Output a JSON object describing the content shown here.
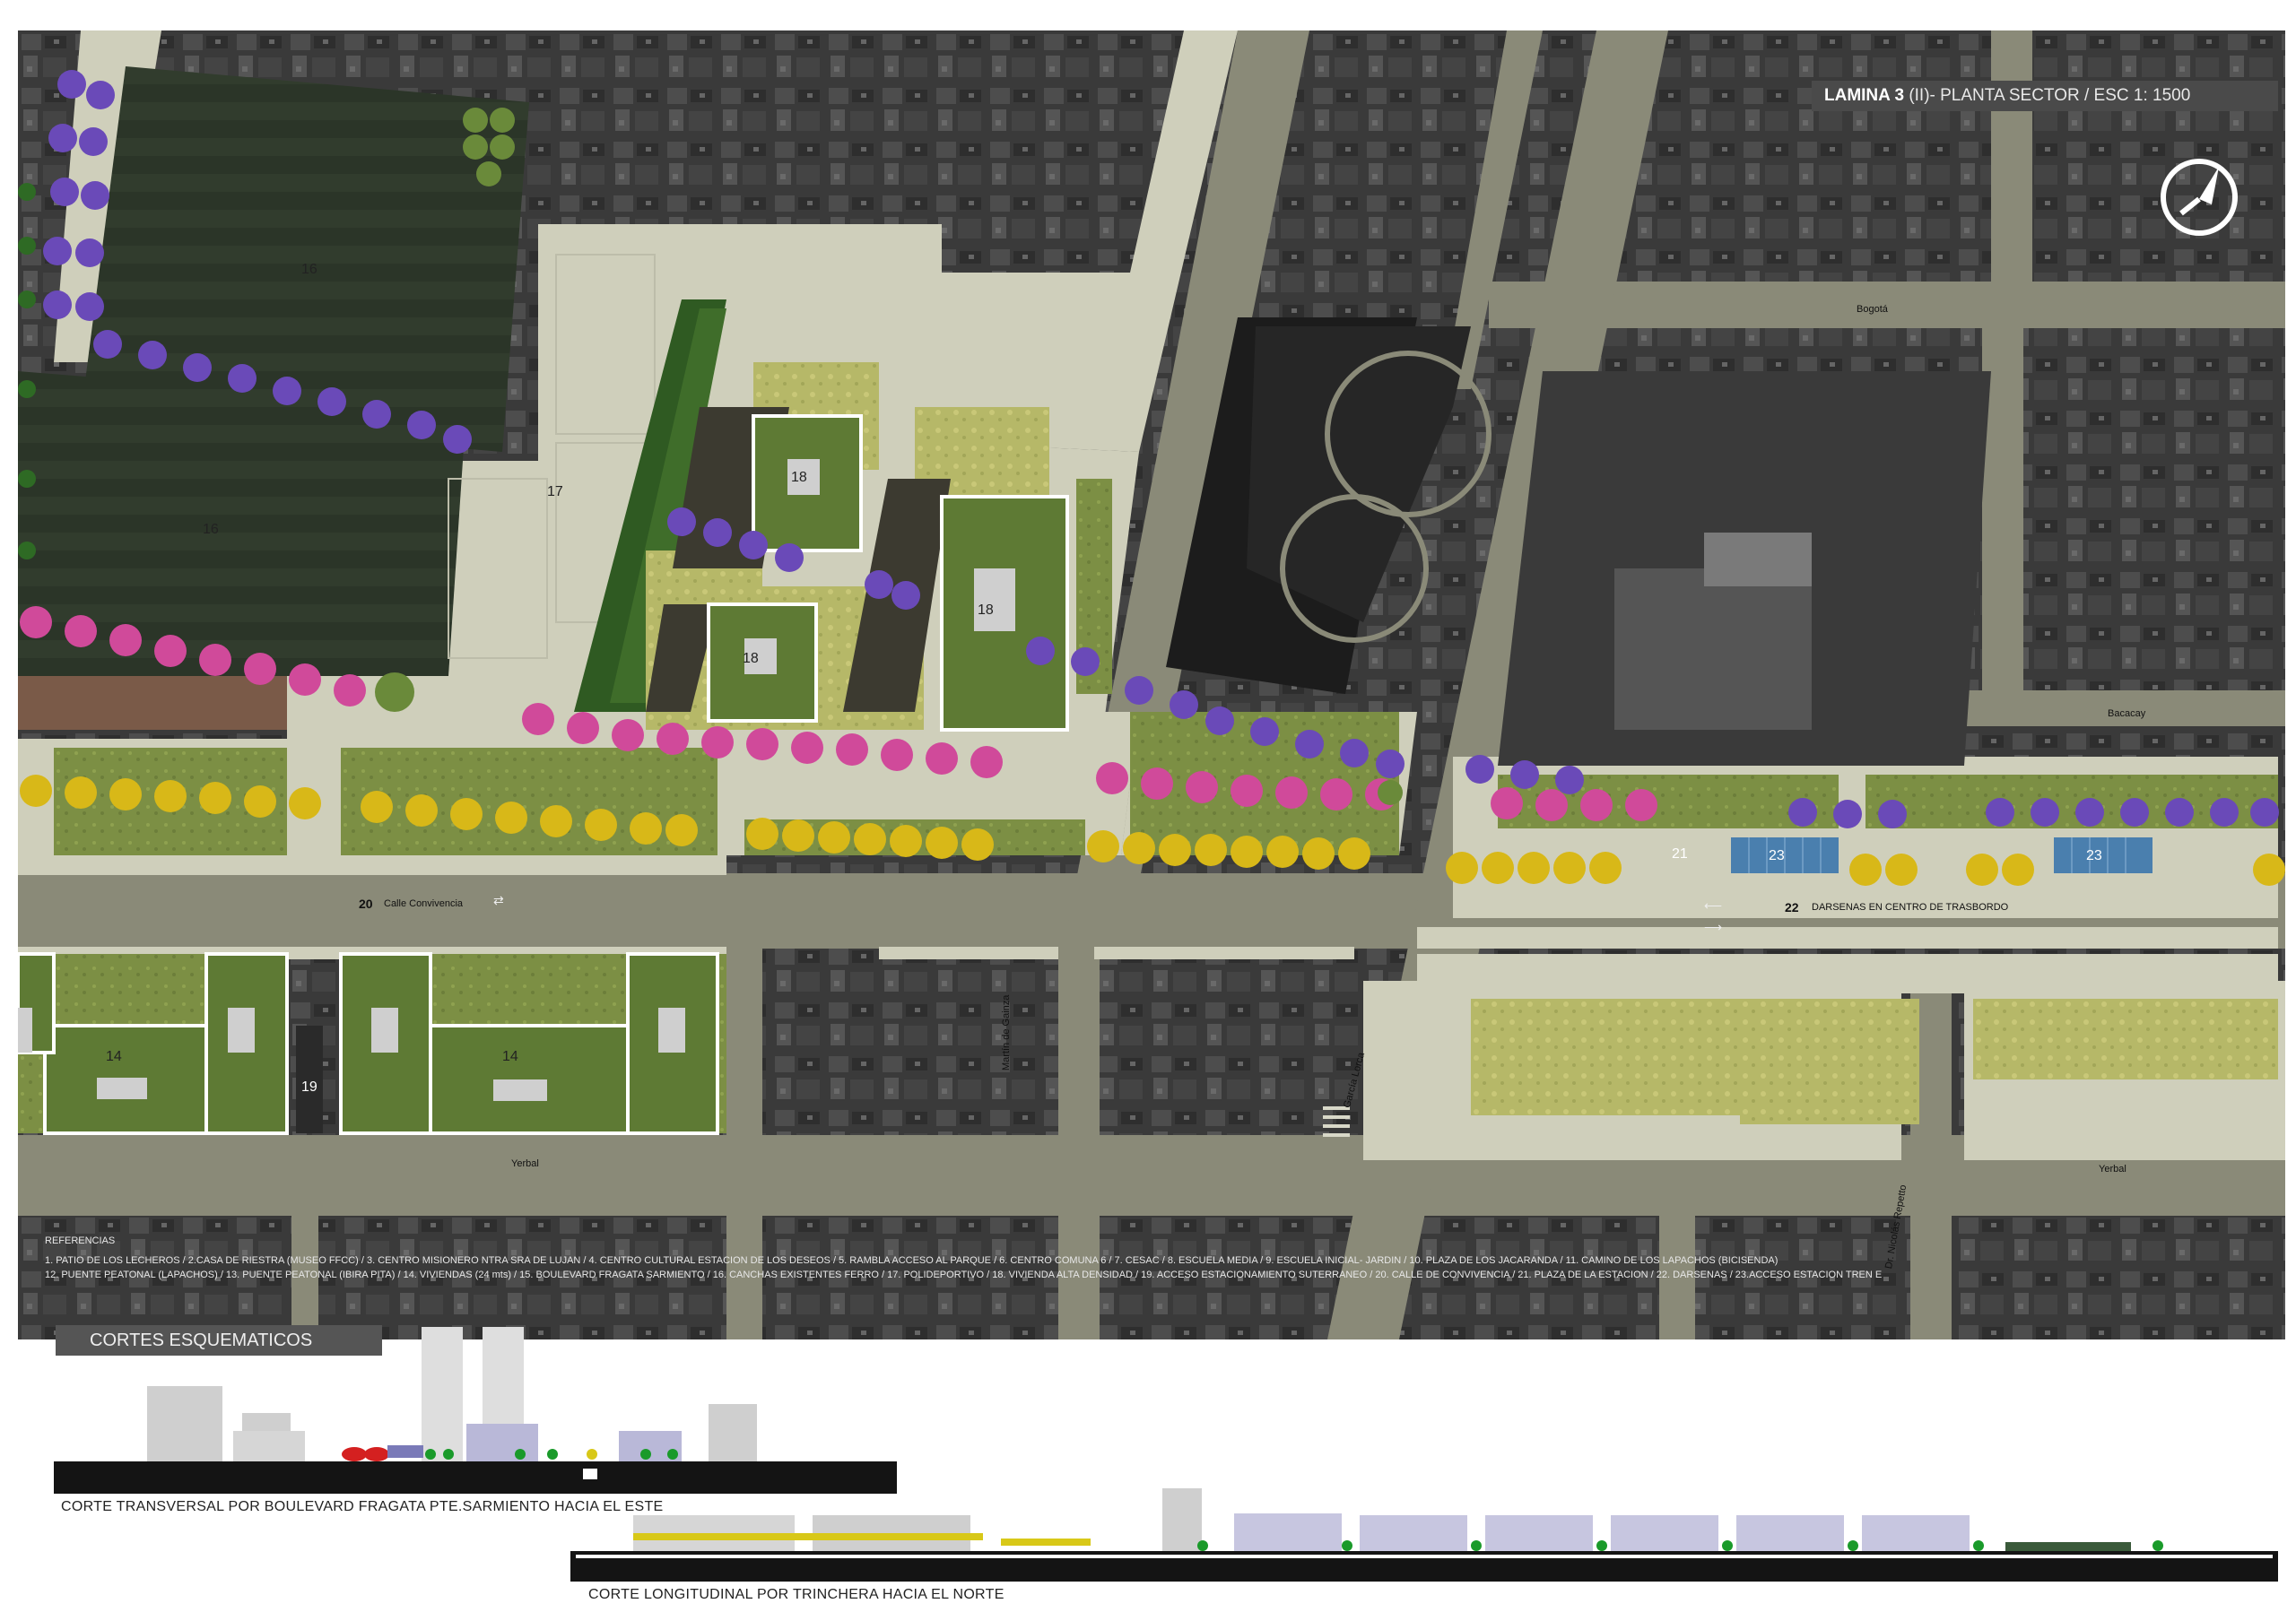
{
  "title": {
    "lamina": "LAMINA 3",
    "subtitle": "(II)- PLANTA SECTOR  / ESC 1: 1500"
  },
  "north_icon": "north-arrow-icon",
  "streets": {
    "bogota": "Bogotá",
    "bacacay": "Bacacay",
    "yerbal_left": "Yerbal",
    "yerbal_right": "Yerbal",
    "martin_de_gainza": "Martín de Gainza",
    "garcia_lorca": "García Lorca",
    "nicolas_repetto": "Dr. Nicolás Repetto",
    "calle_convivencia_num": "20",
    "calle_convivencia": "Calle Convivencia",
    "darsenas_num": "22",
    "darsenas": "DARSENAS EN CENTRO DE TRASBORDO"
  },
  "plot_numbers": {
    "p16a": "16",
    "p16b": "16",
    "p17": "17",
    "p18a": "18",
    "p18b": "18",
    "p18c": "18",
    "p14a": "14",
    "p14b": "14",
    "p19": "19",
    "p21": "21",
    "p23a": "23",
    "p23b": "23"
  },
  "references": {
    "heading": "REFERENCIAS",
    "line1": "1. PATIO DE LOS LECHEROS  / 2.CASA DE RIESTRA (MUSEO FFCC)  / 3. CENTRO MISIONERO NTRA SRA DE LUJAN  / 4. CENTRO CULTURAL ESTACION DE LOS DESEOS  / 5. RAMBLA ACCESO AL PARQUE  / 6. CENTRO COMUNA 6  / 7. CESAC  / 8. ESCUELA MEDIA  / 9. ESCUELA INICIAL- JARDIN  / 10. PLAZA DE LOS JACARANDA / 11. CAMINO DE LOS LAPACHOS (BICISENDA)",
    "line2": "12. PUENTE PEATONAL (LAPACHOS) / 13. PUENTE PEATONAL (IBIRA PITA) / 14. VIVIENDAS (24 mts)  /  15. BOULEVARD FRAGATA SARMIENTO / 16. CANCHAS EXISTENTES FERRO / 17. POLIDEPORTIVO / 18. VIVIENDA ALTA DENSIDAD / 19. ACCESO ESTACIONAMIENTO SUTERRANEO / 20. CALLE DE CONVIVENCIA / 21. PLAZA DE LA ESTACION / 22. DARSENAS / 23.ACCESO ESTACION TREN E"
  },
  "sections": {
    "title": "CORTES ESQUEMATICOS",
    "transversal": "CORTE TRANSVERSAL  POR BOULEVARD FRAGATA PTE.SARMIENTO HACIA EL ESTE",
    "longitudinal": "CORTE LONGITUDINAL  POR TRINCHERA  HACIA EL NORTE"
  },
  "colors": {
    "street": "#8a8a78",
    "sidewalk": "#c9c9b5",
    "grass": "#6e8a3e",
    "lawn": "#9aa85a",
    "pink_tree": "#d04a9a",
    "purple_tree": "#6a4ab8",
    "yellow_tree": "#d8b818",
    "building_green": "#5e7a34"
  }
}
